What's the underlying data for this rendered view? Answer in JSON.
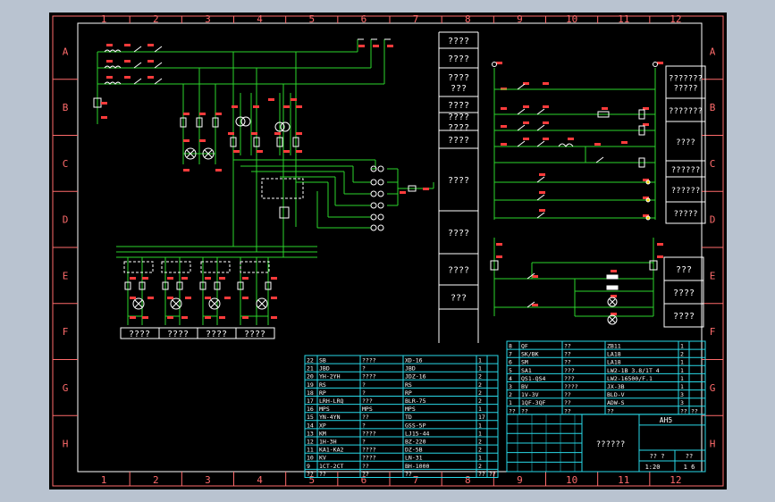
{
  "zone_columns": [
    "1",
    "2",
    "3",
    "4",
    "5",
    "6",
    "7",
    "8",
    "9",
    "10",
    "11",
    "12"
  ],
  "zone_rows": [
    "A",
    "B",
    "C",
    "D",
    "E",
    "F",
    "G",
    "H"
  ],
  "left_column": [
    {
      "text": "????"
    },
    {
      "text": "????"
    },
    {
      "text": "????\n???"
    },
    {
      "text": "????"
    },
    {
      "text": "????\n????"
    },
    {
      "text": "????"
    },
    {
      "text": "????"
    },
    {
      "text": "????"
    },
    {
      "text": "????"
    },
    {
      "text": "???"
    }
  ],
  "right_column": [
    {
      "text": "???????\n?????"
    },
    {
      "text": "???????"
    },
    {
      "text": "????"
    },
    {
      "text": "??????"
    },
    {
      "text": "??????"
    },
    {
      "text": "?????"
    }
  ],
  "side_notes": [
    "???",
    "????",
    "????"
  ],
  "bottom_labels": [
    "????",
    "????",
    "????",
    "????"
  ],
  "bom_left": [
    [
      "22",
      "SB",
      "????",
      "XD-16",
      "1",
      ""
    ],
    [
      "21",
      "JBD",
      "?",
      "JBD",
      "1",
      ""
    ],
    [
      "20",
      "YH-2YH",
      "????",
      "JDZ-16",
      "2",
      ""
    ],
    [
      "19",
      "RS",
      "?",
      "RS",
      "2",
      ""
    ],
    [
      "18",
      "RP",
      "?",
      "RP",
      "2",
      ""
    ],
    [
      "17",
      "LRH-LRQ",
      "???",
      "BLR-75",
      "2",
      ""
    ],
    [
      "16",
      "MPS",
      "MPS",
      "MPS",
      "1",
      ""
    ],
    [
      "15",
      "YN-4YN",
      "??",
      "TD",
      "17",
      ""
    ],
    [
      "14",
      "XP",
      "?",
      "GSS-5P",
      "1",
      ""
    ],
    [
      "13",
      "KM",
      "????",
      "LJ15-44",
      "1",
      ""
    ],
    [
      "12",
      "1H-3H",
      "?",
      "BZ-220",
      "2",
      ""
    ],
    [
      "11",
      "KA1-KA2",
      "????",
      "DZ-5B",
      "2",
      ""
    ],
    [
      "10",
      "KV",
      "????",
      "LN-31",
      "1",
      ""
    ],
    [
      "9",
      "1CT-2CT",
      "??",
      "BH-1000",
      "2",
      ""
    ]
  ],
  "bom_right": [
    [
      "8",
      "QF",
      "??",
      "ZB11",
      "1",
      ""
    ],
    [
      "7",
      "SK/BK",
      "??",
      "LA18",
      "2",
      ""
    ],
    [
      "6",
      "SM",
      "??",
      "LA18",
      "1",
      ""
    ],
    [
      "5",
      "SA1",
      "???",
      "LW2-1B 3.8/1T 4",
      "1",
      ""
    ],
    [
      "4",
      "QS1-QS4",
      "???",
      "LW2-16500/F.1",
      "1",
      ""
    ],
    [
      "3",
      "BV",
      "????",
      "JX-3B",
      "1",
      ""
    ],
    [
      "2",
      "1V-3V",
      "??",
      "BLD-V",
      "3",
      ""
    ],
    [
      "1",
      "1QF-3QF",
      "??",
      "ADW-S",
      "3",
      ""
    ]
  ],
  "table_headers_left": [
    "??",
    "??",
    "??",
    "??",
    "??",
    "??"
  ],
  "table_headers_right": [
    "??",
    "??",
    "??",
    "??",
    "??",
    "??"
  ],
  "title_block": {
    "title": "??????",
    "drawing_no": "AH5",
    "scale": "1:20",
    "sheet": "1 6",
    "ratio_label": "?? ?",
    "weight_label": "??"
  }
}
